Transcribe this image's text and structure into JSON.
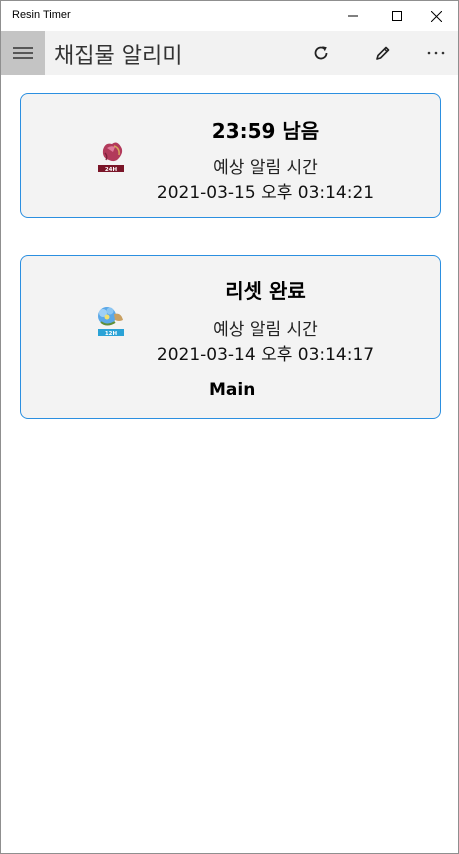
{
  "window": {
    "title": "Resin Timer"
  },
  "appbar": {
    "title": "채집물 알리미"
  },
  "icons": {
    "menu": "hamburger-icon",
    "refresh": "refresh-icon",
    "edit": "pencil-icon",
    "more": "more-icon",
    "minimize": "minimize-icon",
    "maximize": "maximize-icon",
    "close": "close-icon"
  },
  "colors": {
    "card_border": "#2b8fe0",
    "card_bg": "#f3f3f3",
    "appbar_bg": "#f2f2f2",
    "hamburger_bg": "#c4c4c4"
  },
  "timers": [
    {
      "badge": "24H",
      "status": "23:59 남음",
      "expected_label": "예상 알림 시간",
      "expected_time": "2021-03-15 오후 03:14:21",
      "name": ""
    },
    {
      "badge": "12H",
      "status": "리셋 완료",
      "expected_label": "예상 알림 시간",
      "expected_time": "2021-03-14 오후 03:14:17",
      "name": "Main"
    }
  ]
}
